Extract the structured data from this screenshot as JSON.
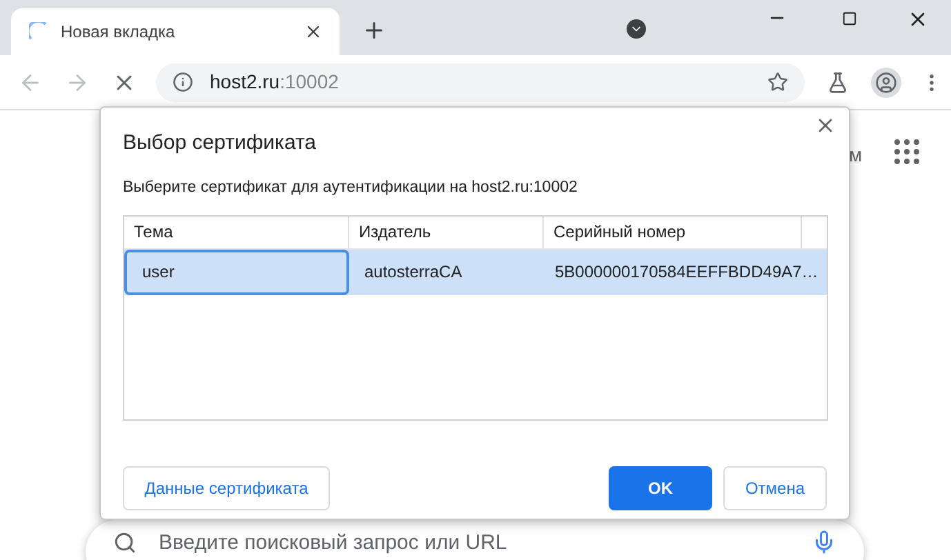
{
  "tab": {
    "title": "Новая вкладка",
    "loading": true
  },
  "address_bar": {
    "host": "host2.ru",
    "port": ":10002"
  },
  "page": {
    "partial_text": "м",
    "search": {
      "placeholder": "Введите поисковый запрос или URL"
    }
  },
  "dialog": {
    "title": "Выбор сертификата",
    "subtitle": "Выберите сертификат для аутентификации на host2.ru:10002",
    "table": {
      "columns": [
        "Тема",
        "Издатель",
        "Серийный номер"
      ],
      "rows": [
        {
          "cells": [
            "user",
            "autosterraCA",
            "5B000000170584EEFFBDD49A7…"
          ],
          "selected": true
        }
      ]
    },
    "buttons": [
      {
        "label": "Данные сертификата",
        "kind": "secondary"
      },
      {
        "label": "OK",
        "kind": "primary"
      },
      {
        "label": "Отмена",
        "kind": "secondary"
      }
    ]
  }
}
